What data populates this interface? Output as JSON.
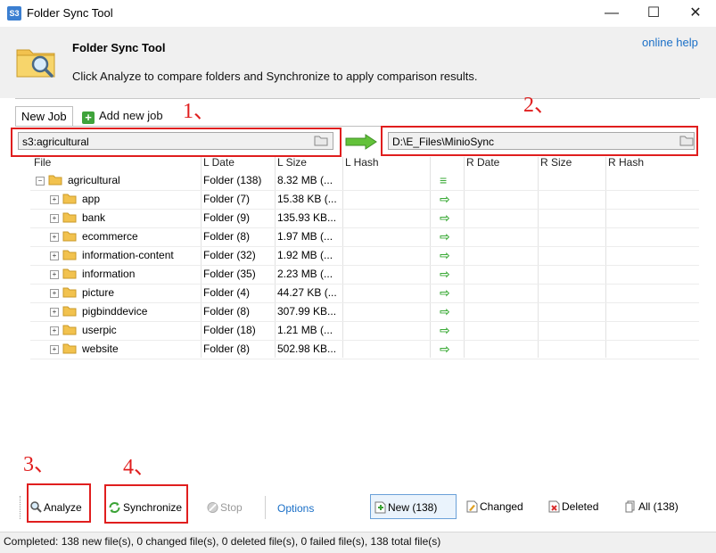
{
  "window": {
    "title": "Folder Sync Tool",
    "icon_text": "S3"
  },
  "header": {
    "title": "Folder Sync Tool",
    "description": "Click Analyze to compare folders and Synchronize to apply comparison results.",
    "online_help": "online help"
  },
  "tabs": [
    {
      "label": "New Job"
    },
    {
      "label": "Add new job"
    }
  ],
  "paths": {
    "left": "s3:agricultural",
    "right": "D:\\E_Files\\MinioSync"
  },
  "annotations": [
    "1、",
    "2、",
    "3、",
    "4、"
  ],
  "columns": [
    "File",
    "L Date",
    "L Size",
    "L Hash",
    "R Date",
    "R Size",
    "R Hash"
  ],
  "rows": [
    {
      "name": "agricultural",
      "ldate": "Folder (138)",
      "lsize": "8.32 MB (...",
      "action": "equal",
      "root": true
    },
    {
      "name": "app",
      "ldate": "Folder (7)",
      "lsize": "15.38 KB (...",
      "action": "right"
    },
    {
      "name": "bank",
      "ldate": "Folder (9)",
      "lsize": "135.93 KB...",
      "action": "right"
    },
    {
      "name": "ecommerce",
      "ldate": "Folder (8)",
      "lsize": "1.97 MB (...",
      "action": "right"
    },
    {
      "name": "information-content",
      "ldate": "Folder (32)",
      "lsize": "1.92 MB (...",
      "action": "right"
    },
    {
      "name": "information",
      "ldate": "Folder (35)",
      "lsize": "2.23 MB (...",
      "action": "right"
    },
    {
      "name": "picture",
      "ldate": "Folder (4)",
      "lsize": "44.27 KB (...",
      "action": "right"
    },
    {
      "name": "pigbinddevice",
      "ldate": "Folder (8)",
      "lsize": "307.99 KB...",
      "action": "right"
    },
    {
      "name": "userpic",
      "ldate": "Folder (18)",
      "lsize": "1.21 MB (...",
      "action": "right"
    },
    {
      "name": "website",
      "ldate": "Folder (8)",
      "lsize": "502.98 KB...",
      "action": "right"
    }
  ],
  "toolbar": {
    "analyze": "Analyze",
    "synchronize": "Synchronize",
    "stop": "Stop",
    "options": "Options",
    "filter_new": "New (138)",
    "filter_changed": "Changed",
    "filter_deleted": "Deleted",
    "filter_all": "All (138)"
  },
  "status": "Completed: 138 new file(s), 0 changed file(s), 0 deleted file(s), 0 failed file(s), 138 total file(s)",
  "colors": {
    "accent": "#1a6fc7",
    "annotation": "#e01e1e",
    "arrow": "#39a935",
    "folder": "#f2c24e"
  }
}
